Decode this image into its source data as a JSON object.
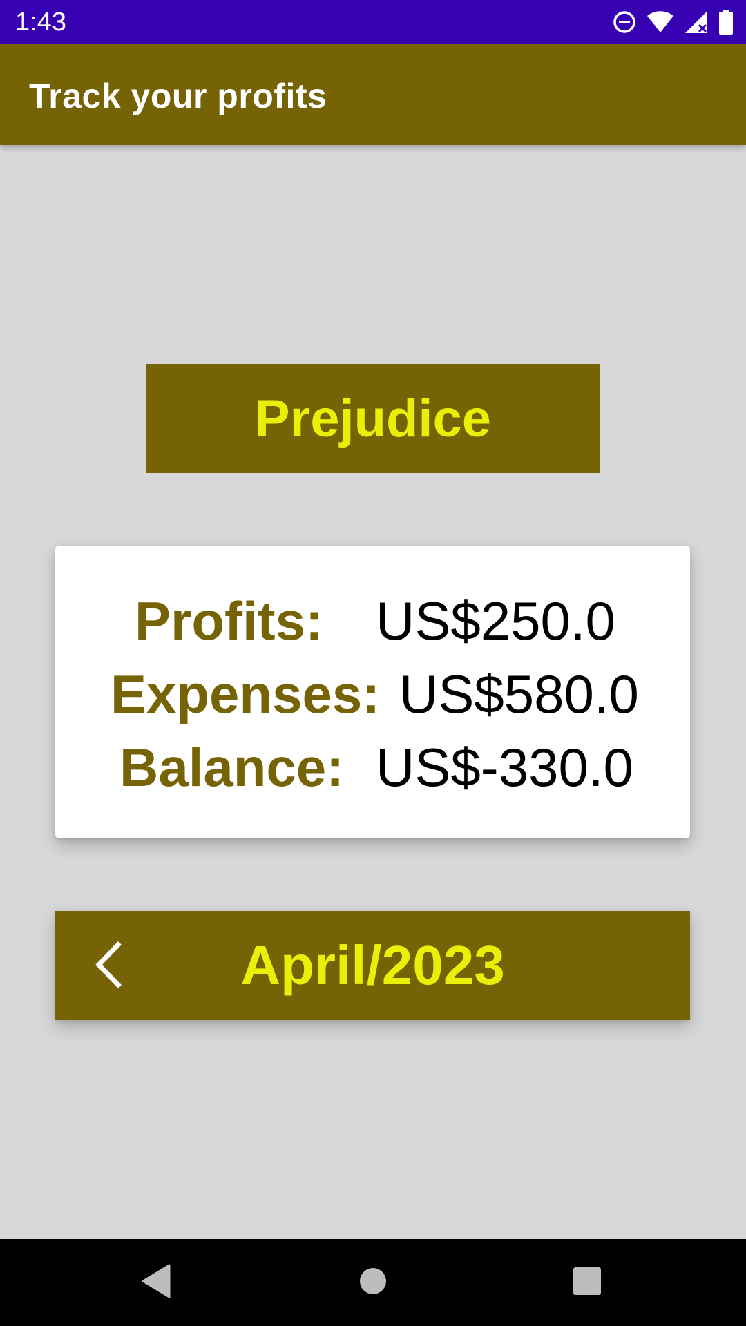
{
  "status_bar": {
    "time": "1:43",
    "icons": [
      "do-not-disturb-icon",
      "wifi-icon",
      "cell-signal-icon",
      "battery-icon"
    ]
  },
  "app_bar": {
    "title": "Track your profits"
  },
  "category": {
    "label": "Prejudice"
  },
  "summary": {
    "profits_label": "Profits:",
    "profits_value": "US$250.0",
    "expenses_label": "Expenses:",
    "expenses_value": "US$580.0",
    "balance_label": "Balance:",
    "balance_value": "US$-330.0"
  },
  "month_nav": {
    "label": "April/2023",
    "prev_icon": "chevron-left-icon"
  },
  "nav_bar": {
    "icons": [
      "back-icon",
      "home-icon",
      "recents-icon"
    ]
  },
  "colors": {
    "status_bar": "#3700b3",
    "primary": "#756306",
    "accent_text": "#e8f00a",
    "background": "#d8d8d8",
    "card": "#ffffff"
  }
}
